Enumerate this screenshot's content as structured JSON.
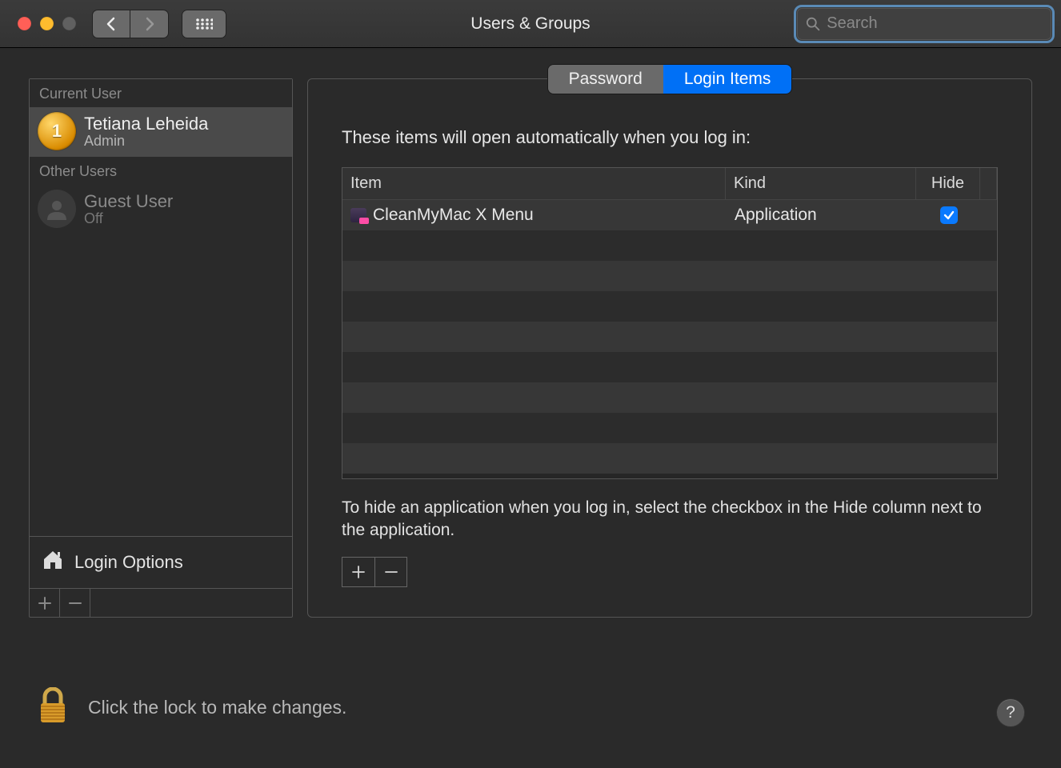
{
  "window": {
    "title": "Users & Groups",
    "search_placeholder": "Search"
  },
  "sidebar": {
    "current_user_header": "Current User",
    "other_users_header": "Other Users",
    "current_user": {
      "name": "Tetiana Leheida",
      "role": "Admin"
    },
    "other_users": [
      {
        "name": "Guest User",
        "role": "Off"
      }
    ],
    "login_options_label": "Login Options"
  },
  "tabs": {
    "password": "Password",
    "login_items": "Login Items",
    "active": "login_items"
  },
  "main": {
    "instruction": "These items will open automatically when you log in:",
    "columns": {
      "item": "Item",
      "kind": "Kind",
      "hide": "Hide"
    },
    "items": [
      {
        "name": "CleanMyMac X Menu",
        "kind": "Application",
        "hide": true
      }
    ],
    "hint": "To hide an application when you log in, select the checkbox in the Hide column next to the application."
  },
  "footer": {
    "lock_text": "Click the lock to make changes.",
    "help_label": "?"
  }
}
